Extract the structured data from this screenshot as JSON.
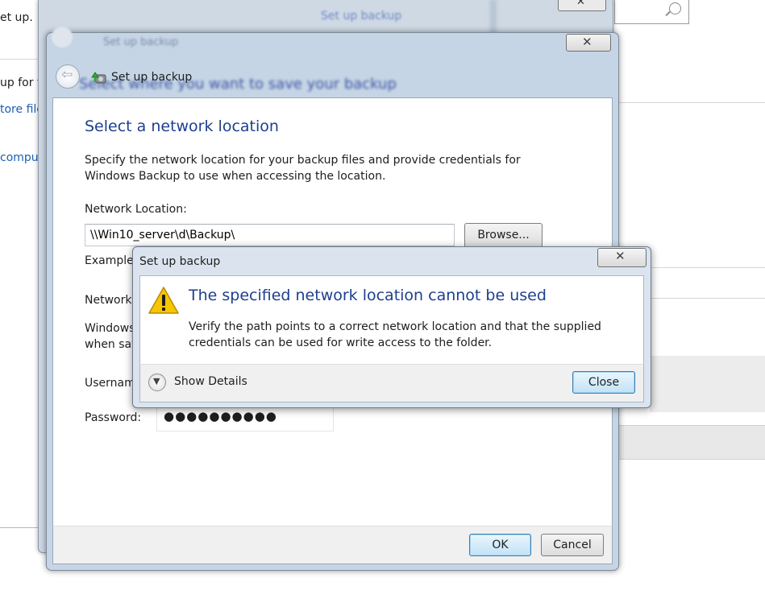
{
  "background_window": {
    "fragments": [
      "et up.",
      "up for th",
      "tore file",
      "compu"
    ]
  },
  "middle_window": {
    "title": "Set up backup"
  },
  "main_dialog": {
    "title": "Set up backup",
    "ghost_title": "Set up backup",
    "ghost_heading": "Select where you want to save your backup",
    "heading": "Select a network location",
    "instructions": "Specify the network location for your backup files and provide credentials for Windows Backup to use when accessing the location.",
    "network_location_label": "Network Location:",
    "network_location_value": "\\\\Win10_server\\d\\Backup\\",
    "browse_label": "Browse...",
    "example_label": "Example:",
    "network_credentials_label": "Network",
    "windows_text_line1": "Windows",
    "windows_text_line2": "when sav",
    "username_label": "Username",
    "password_label": "Password:",
    "password_value": "●●●●●●●●●●",
    "ok_label": "OK",
    "cancel_label": "Cancel"
  },
  "error_dialog": {
    "title": "Set up backup",
    "heading": "The specified network location cannot be used",
    "message": "Verify the path points to a correct network location and that the supplied credentials can be used for write access to the folder.",
    "show_details_label": "Show Details",
    "close_label": "Close"
  },
  "colors": {
    "heading_blue": "#1d3f8f",
    "link_blue": "#1a5fb4",
    "frame_blue": "#c6d5e6",
    "warning_yellow": "#f7c600"
  },
  "icons": [
    "search-icon",
    "close-icon",
    "back-arrow-icon",
    "backup-app-icon",
    "warning-icon",
    "chevron-down-icon"
  ]
}
